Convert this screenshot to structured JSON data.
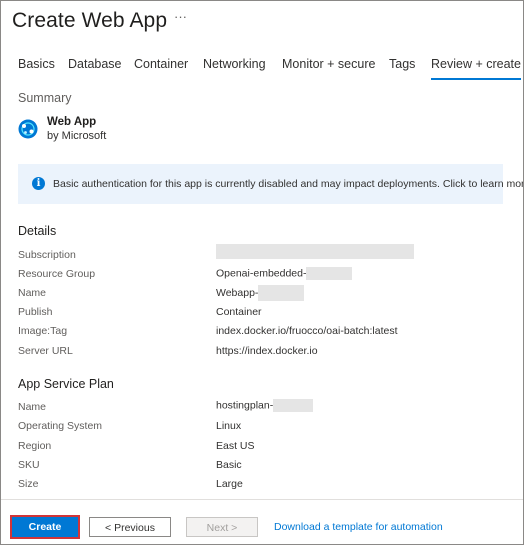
{
  "header": {
    "title": "Create Web App",
    "more_label": "···"
  },
  "tabs": [
    {
      "label": "Basics"
    },
    {
      "label": "Database"
    },
    {
      "label": "Container"
    },
    {
      "label": "Networking"
    },
    {
      "label": "Monitor + secure"
    },
    {
      "label": "Tags"
    },
    {
      "label": "Review + create",
      "active": true
    }
  ],
  "summary": {
    "heading": "Summary",
    "product_name": "Web App",
    "product_by": "by Microsoft",
    "product_icon": "web-app-icon"
  },
  "info_bar": {
    "icon": "info-icon",
    "text": "Basic authentication for this app is currently disabled and may impact deployments. Click to learn more."
  },
  "details": {
    "heading": "Details",
    "rows": [
      {
        "label": "Subscription",
        "value": ""
      },
      {
        "label": "Resource Group",
        "value": "Openai-embedded-"
      },
      {
        "label": "Name",
        "value": "Webapp-"
      },
      {
        "label": "Publish",
        "value": "Container"
      },
      {
        "label": "Image:Tag",
        "value": "index.docker.io/fruocco/oai-batch:latest"
      },
      {
        "label": "Server URL",
        "value": "https://index.docker.io"
      }
    ]
  },
  "plan": {
    "heading": "App Service Plan",
    "rows": [
      {
        "label": "Name",
        "value": "hostingplan-"
      },
      {
        "label": "Operating System",
        "value": "Linux"
      },
      {
        "label": "Region",
        "value": "East US"
      },
      {
        "label": "SKU",
        "value": "Basic"
      },
      {
        "label": "Size",
        "value": "Large"
      }
    ]
  },
  "footer": {
    "create_label": "Create",
    "previous_label": "< Previous",
    "next_label": "Next >",
    "download_link": "Download a template for automation"
  },
  "colors": {
    "accent": "#0078d4",
    "highlight_border": "#d13438",
    "info_bg": "#ebf3fc"
  }
}
